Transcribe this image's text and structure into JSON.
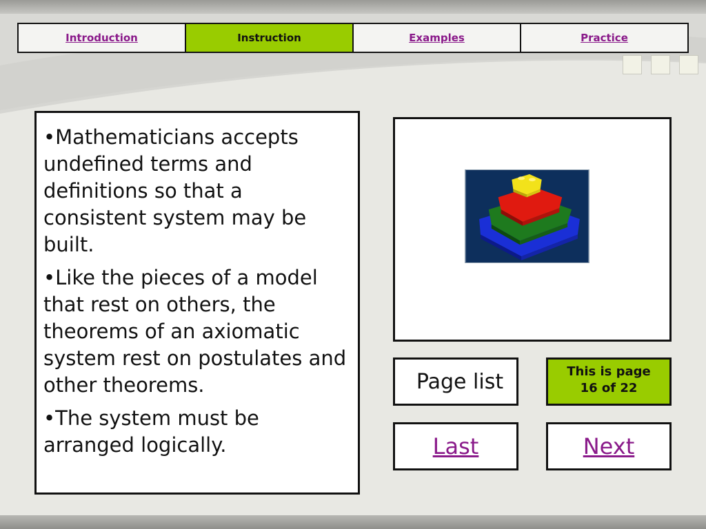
{
  "nav": {
    "tabs": [
      {
        "label": "Introduction",
        "active": false
      },
      {
        "label": "Instruction",
        "active": true
      },
      {
        "label": "Examples",
        "active": false
      },
      {
        "label": "Practice",
        "active": false
      }
    ]
  },
  "content": {
    "bullets": [
      "•Mathematicians accepts undefined terms and definitions so that a consistent system may be built.",
      "•Like the pieces of a model that rest on others, the theorems of an axiomatic system rest on postulates and other theorems.",
      "•The system must be arranged logically."
    ]
  },
  "sidebar": {
    "page_list_label": "Page list",
    "page_count_line1": "This is page",
    "page_count_line2": "16 of 22",
    "last_label": "Last",
    "next_label": "Next"
  },
  "colors": {
    "accent_green": "#99cc00",
    "link_purple": "#8a1a8a"
  },
  "icons": {
    "lego_image": "lego-pyramid-image"
  }
}
